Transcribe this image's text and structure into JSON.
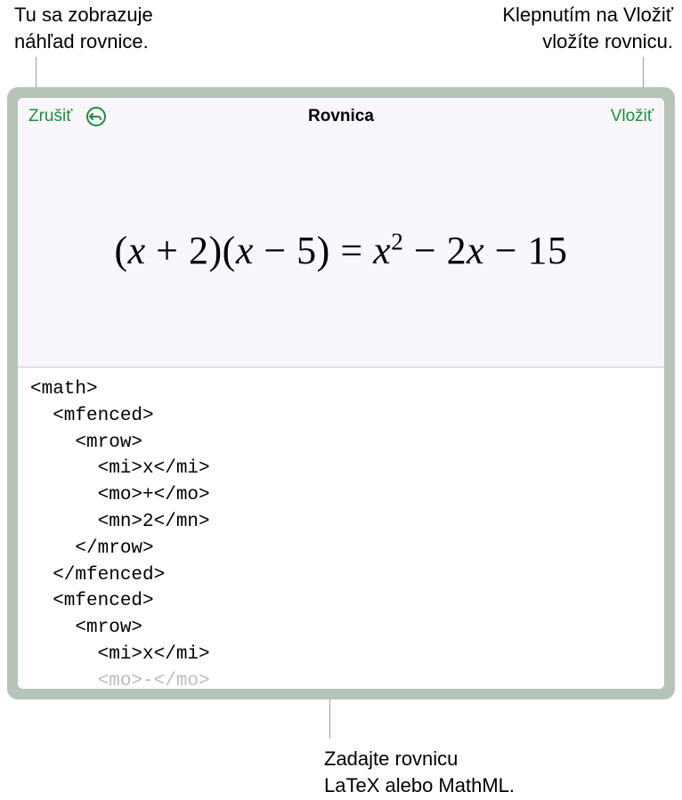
{
  "callouts": {
    "preview_hint_l1": "Tu sa zobrazuje",
    "preview_hint_l2": "náhľad rovnice.",
    "insert_hint_l1": "Klepnutím na Vložiť",
    "insert_hint_l2": "vložíte rovnicu.",
    "input_hint_l1": "Zadajte rovnicu",
    "input_hint_l2": "LaTeX alebo MathML."
  },
  "header": {
    "cancel": "Zrušiť",
    "title": "Rovnica",
    "insert": "Vložiť"
  },
  "equation": {
    "lhs_open1": "(",
    "lhs_x1": "x",
    "lhs_plus": " + ",
    "lhs_2": "2",
    "lhs_close1": ")(",
    "lhs_x2": "x",
    "lhs_minus": " − ",
    "lhs_5": "5",
    "lhs_close2": ")",
    "eq": " = ",
    "rhs_x": "x",
    "rhs_sq": "2",
    "rhs_m1": " − 2",
    "rhs_x3": "x",
    "rhs_m2": " − 15"
  },
  "code": "<math>\n  <mfenced>\n    <mrow>\n      <mi>x</mi>\n      <mo>+</mo>\n      <mn>2</mn>\n    </mrow>\n  </mfenced>\n  <mfenced>\n    <mrow>\n      <mi>x</mi>",
  "code_fade": "\n      <mo>-</mo>"
}
